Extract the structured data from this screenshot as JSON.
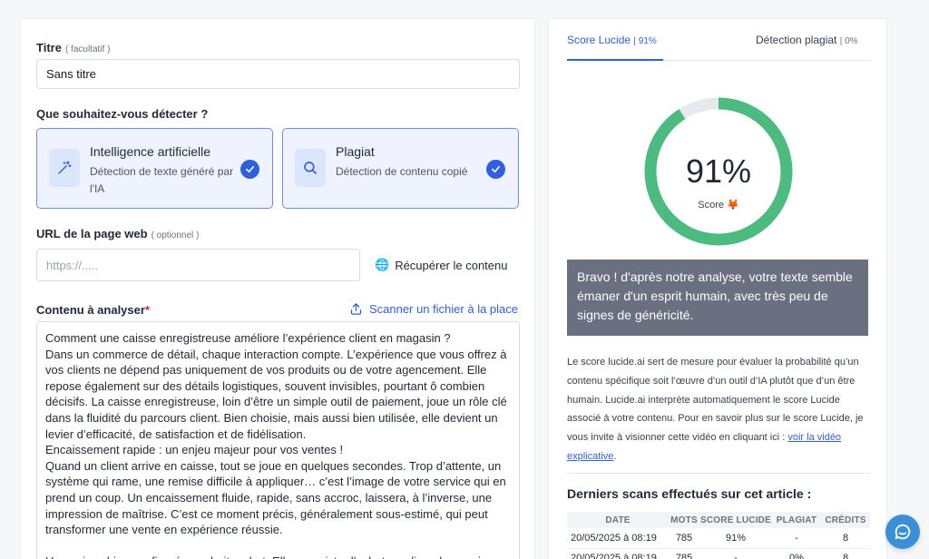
{
  "form": {
    "title_label": "Titre",
    "title_hint": "( facultatif )",
    "title_value": "Sans titre",
    "detect_label": "Que souhaitez-vous détecter ?",
    "options": [
      {
        "title": "Intelligence artificielle",
        "desc": "Détection de texte généré par l'IA",
        "icon": "magic-wand-icon",
        "selected": true
      },
      {
        "title": "Plagiat",
        "desc": "Détection de contenu copié",
        "icon": "search-icon",
        "selected": true
      }
    ],
    "url_label": "URL de la page web",
    "url_hint": "( optionnel )",
    "url_placeholder": "https://.....",
    "fetch_label": "Récupérer le contenu",
    "content_label": "Contenu à analyser",
    "content_required_mark": "*",
    "scan_file_label": "Scanner un fichier à la place",
    "content_text": "Comment une caisse enregistreuse améliore l’expérience client en magasin ?\nDans un commerce de détail, chaque interaction compte. L’expérience que vous offrez à vos clients ne dépend pas uniquement de vos produits ou de votre agencement. Elle repose également sur des détails logistiques, souvent invisibles, pourtant ô combien décisifs. La caisse enregistreuse, loin d’être un simple outil de paiement, joue un rôle clé dans la fluidité du parcours client. Bien choisie, mais aussi bien utilisée, elle devient un levier d’efficacité, de satisfaction et de fidélisation.\nEncaissement rapide : un enjeu majeur pour vos ventes !\nQuand un client arrive en caisse, tout se joue en quelques secondes. Trop d’attente, un système qui rame, une remise difficile à appliquer… c’est l’image de votre service qui en prend un coup. Un encaissement fluide, rapide, sans accroc, laissera, à l’inverse, une impression de maîtrise. C’est ce moment précis, généralement sous-estimé, qui peut transformer une vente en expérience réussie.\n\nUne caisse bien configurée va droit au but. Elle enregistre l’achat, applique les remises"
  },
  "results": {
    "tabs": [
      {
        "label": "Score Lucide",
        "pct": "91%",
        "active": true
      },
      {
        "label": "Détection plagiat",
        "pct": "0%",
        "active": false
      }
    ],
    "score_value": "91%",
    "score_fraction": 0.91,
    "score_caption": "Score 🦊",
    "gauge_color": "#4cbb7f",
    "gauge_track_color": "#e8e9ec",
    "verdict": "Bravo ! d'après notre analyse, votre texte semble émaner d'un esprit humain, avec très peu de signes de généricité.",
    "explanation": "Le score lucide.ai sert de mesure pour évaluer la probabilité qu’un contenu spécifique soit l’œuvre d’un outil d’IA plutôt que d’un être humain. Lucide.ai interprète automatiquement le score Lucide associé à votre contenu. Pour en savoir plus sur le score Lucide, je vous invite à visionner cette vidéo en cliquant ici : ",
    "video_link": "voir la vidéo explicative",
    "explanation_end": ".",
    "scans_title": "Derniers scans effectués sur cet article :",
    "scans_headers": [
      "DATE",
      "MOTS",
      "SCORE LUCIDE",
      "PLAGIAT",
      "CRÉDITS"
    ],
    "scans_rows": [
      [
        "20/05/2025 à 08:19",
        "785",
        "91%",
        "-",
        "8"
      ],
      [
        "20/05/2025 à 08:19",
        "785",
        "-",
        "0%",
        "8"
      ]
    ]
  },
  "accent_color": "#2f5fe0",
  "chat_icon": "chat-bubble-icon"
}
